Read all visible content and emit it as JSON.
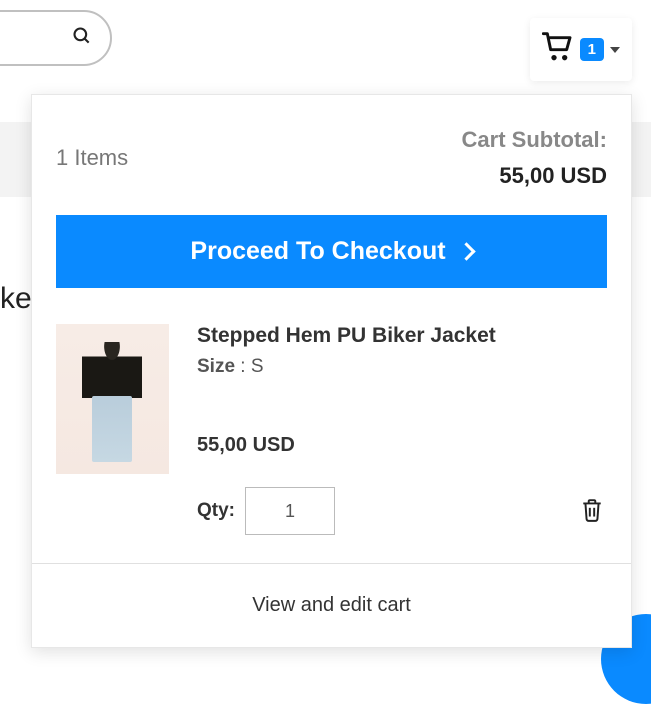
{
  "cart_trigger": {
    "count": "1"
  },
  "mini_cart": {
    "items_text": "1 Items",
    "subtotal_label": "Cart Subtotal:",
    "subtotal_amount": "55,00 USD",
    "checkout_label": "Proceed To Checkout",
    "item": {
      "name": "Stepped Hem PU Biker Jacket",
      "size_label": "Size",
      "size_sep": " : ",
      "size_value": "S",
      "price": "55,00 USD",
      "qty_label": "Qty:",
      "qty_value": "1"
    },
    "view_edit_label": "View and edit cart"
  },
  "page": {
    "truncated_text": "ke"
  }
}
